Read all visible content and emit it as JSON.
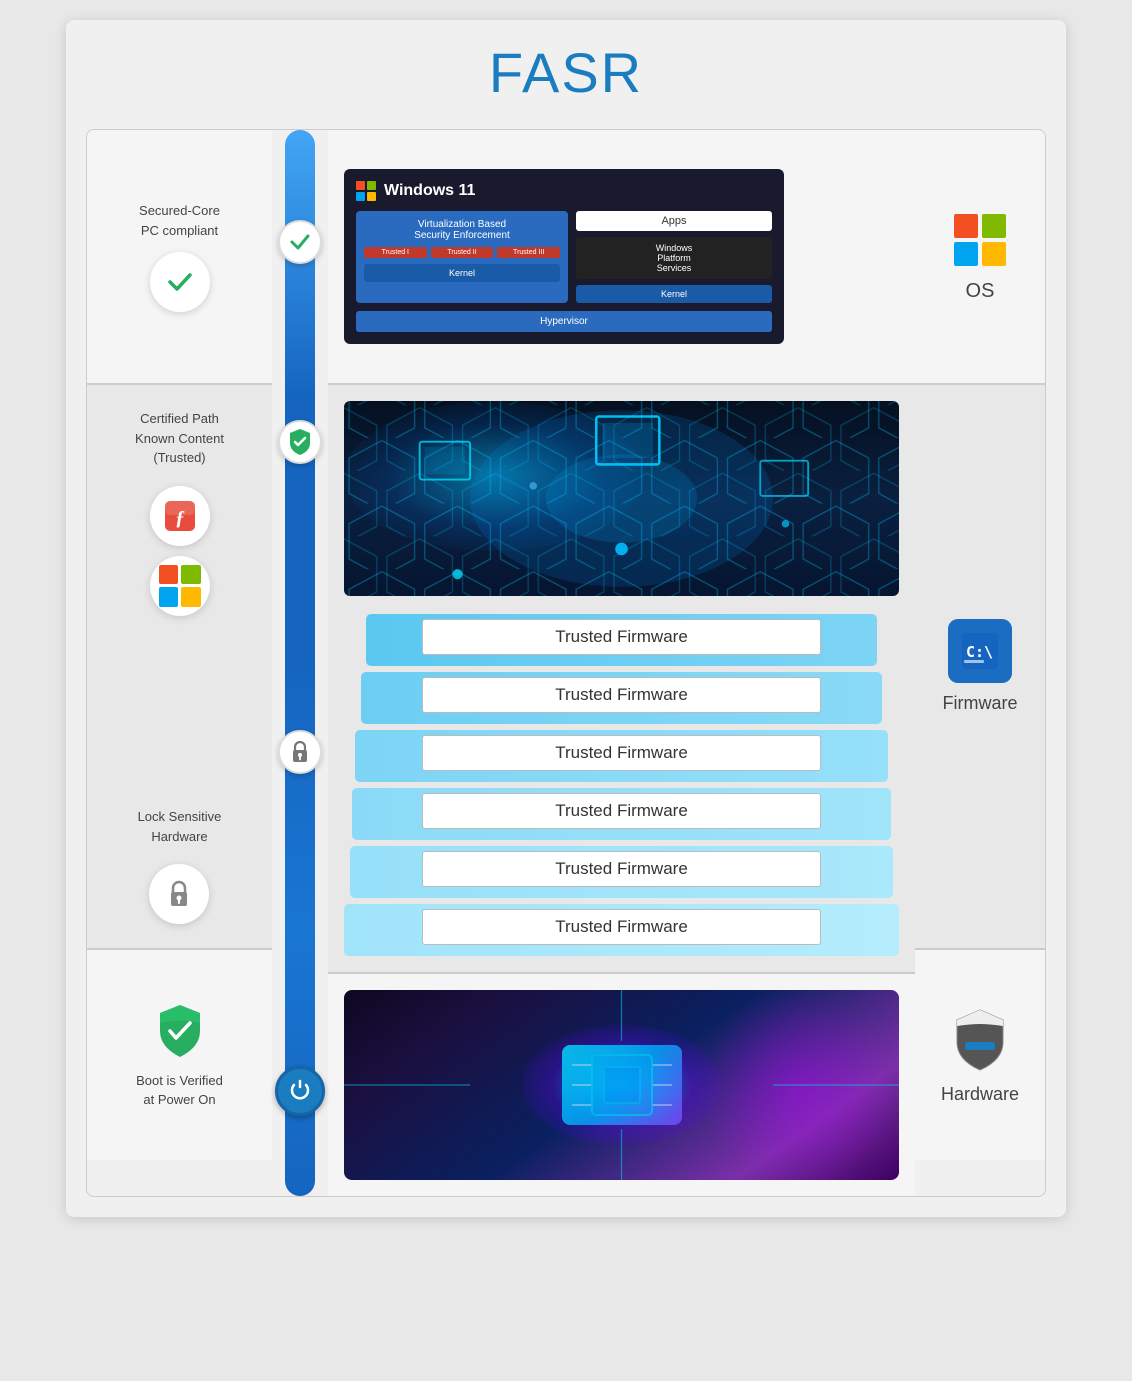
{
  "title": "FASR",
  "sections": {
    "os": {
      "left_label": "Secured-Core\nPC compliant",
      "right_label": "OS",
      "windows_title": "Windows 11",
      "win_vbs": "Virtualization Based\nSecurity Enforcement",
      "win_apps": "Apps",
      "win_platform_services": "Windows\nPlatform\nServices",
      "win_kernel1": "Kernel",
      "win_kernel2": "Kernel",
      "win_hypervisor": "Hypervisor",
      "win_trusted1": "Trusted I",
      "win_trusted2": "Trusted II",
      "win_trusted3": "Trusted III"
    },
    "firmware": {
      "left_label1": "Certified Path\nKnown Content\n(Trusted)",
      "left_label2": "Lock Sensitive\nHardware",
      "right_label": "Firmware",
      "layers": [
        "Trusted Firmware",
        "Trusted Firmware",
        "Trusted Firmware",
        "Trusted Firmware",
        "Trusted Firmware",
        "Trusted Firmware"
      ]
    },
    "hardware": {
      "left_label": "Boot is Verified\nat Power On",
      "right_label": "Hardware"
    }
  }
}
